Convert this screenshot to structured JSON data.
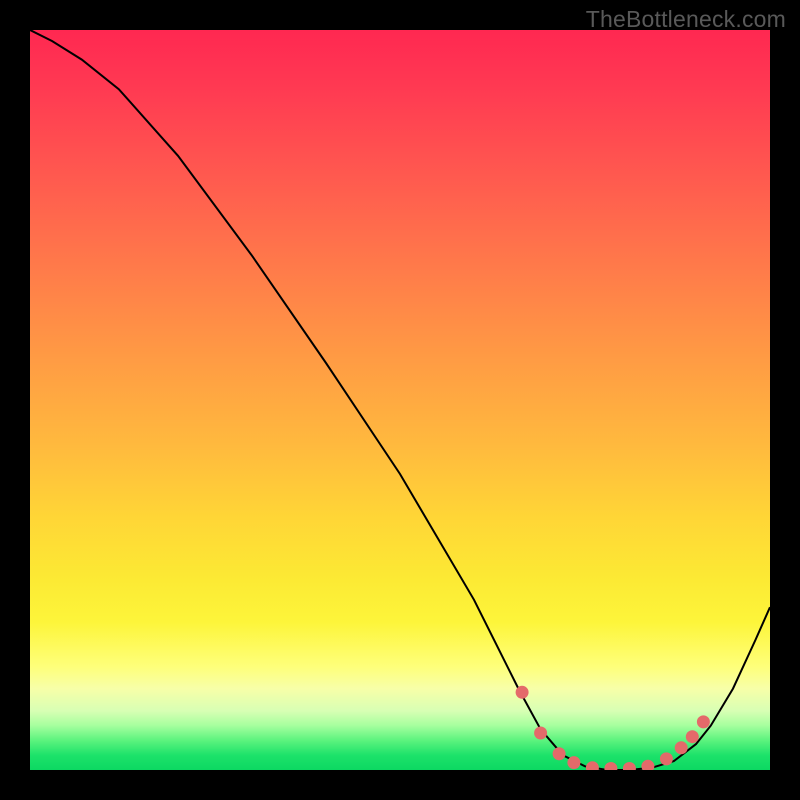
{
  "watermark": "TheBottleneck.com",
  "colors": {
    "background": "#000000",
    "watermark_text": "#595959",
    "curve": "#000000",
    "marker": "#e46a6a"
  },
  "chart_data": {
    "type": "line",
    "title": "",
    "xlabel": "",
    "ylabel": "",
    "xlim": [
      0,
      100
    ],
    "ylim": [
      0,
      100
    ],
    "grid": false,
    "series": [
      {
        "name": "bottleneck-curve",
        "x": [
          0,
          3,
          7,
          12,
          20,
          30,
          40,
          50,
          60,
          66,
          69,
          72,
          75,
          78,
          81,
          84,
          87,
          90,
          92,
          95,
          98,
          100
        ],
        "values": [
          100,
          98.5,
          96,
          92,
          83,
          69.5,
          55,
          40,
          23,
          11,
          5.5,
          2,
          0.5,
          0,
          0,
          0.3,
          1.2,
          3.5,
          6,
          11,
          17.5,
          22
        ]
      }
    ],
    "markers": {
      "name": "valley-dots",
      "x": [
        66.5,
        69,
        71.5,
        73.5,
        76,
        78.5,
        81,
        83.5,
        86,
        88,
        89.5,
        91
      ],
      "values": [
        10.5,
        5.0,
        2.2,
        1.0,
        0.3,
        0.2,
        0.2,
        0.5,
        1.5,
        3.0,
        4.5,
        6.5
      ]
    }
  }
}
